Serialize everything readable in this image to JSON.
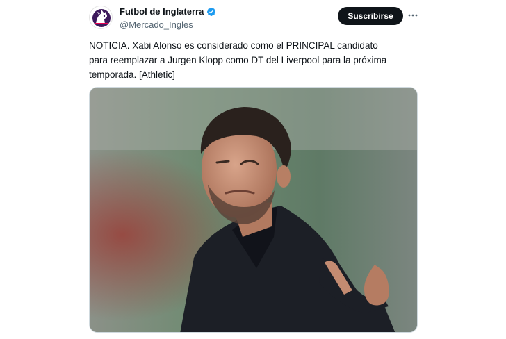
{
  "author": {
    "display_name": "Futbol de Inglaterra",
    "handle": "@Mercado_Ingles",
    "verified": true,
    "avatar_icon": "premier-league-lion-icon"
  },
  "actions": {
    "subscribe_label": "Suscribirse",
    "more_icon": "more-options-icon"
  },
  "tweet": {
    "text_lines": [
      "NOTICIA. Xabi Alonso es considerado como el PRINCIPAL candidato",
      "para reemplazar a Jurgen Klopp como DT del Liverpool para la próxima",
      "temporada. [Athletic]"
    ]
  },
  "colors": {
    "verified_blue": "#1d9bf0",
    "button_bg": "#0f1419",
    "secondary_text": "#536471",
    "avatar_purple": "#3d195b"
  }
}
